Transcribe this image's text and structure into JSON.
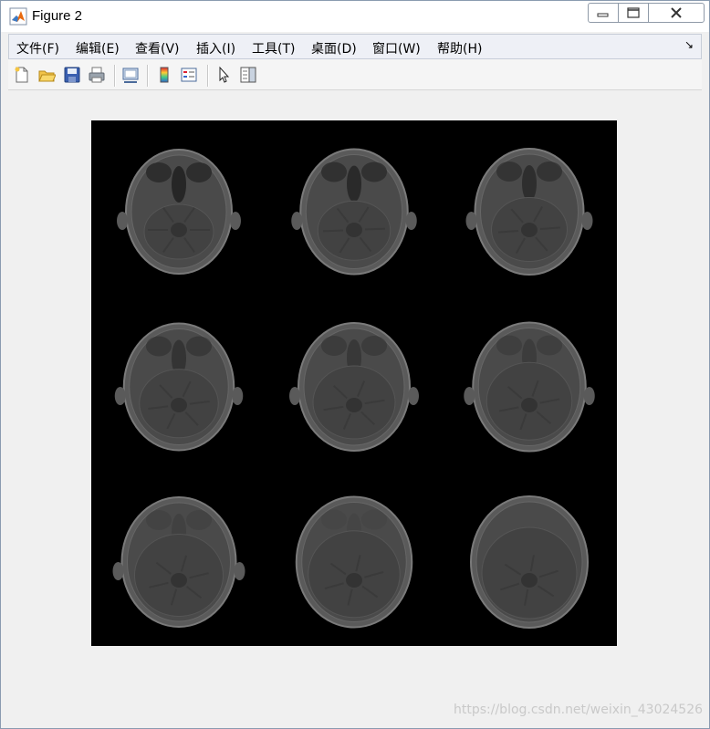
{
  "window": {
    "title": "Figure 2",
    "controls": {
      "minimize": "minimize",
      "maximize": "maximize",
      "close": "close"
    }
  },
  "menubar": {
    "items": [
      {
        "label": "文件(F)"
      },
      {
        "label": "编辑(E)"
      },
      {
        "label": "查看(V)"
      },
      {
        "label": "插入(I)"
      },
      {
        "label": "工具(T)"
      },
      {
        "label": "桌面(D)"
      },
      {
        "label": "窗口(W)"
      },
      {
        "label": "帮助(H)"
      }
    ],
    "dock_arrow": "↘"
  },
  "toolbar": {
    "icons": [
      "new-figure-icon",
      "open-file-icon",
      "save-icon",
      "print-icon",
      "link-plot-icon",
      "colorbar-icon",
      "legend-icon",
      "edit-plot-icon",
      "property-inspector-icon"
    ]
  },
  "figure": {
    "content": "3x3 montage of axial MRI brain slices",
    "grid": {
      "rows": 3,
      "cols": 3
    },
    "colors": {
      "background": "#000000",
      "tissue": "#5a5a5a"
    }
  },
  "watermark": "https://blog.csdn.net/weixin_43024526"
}
